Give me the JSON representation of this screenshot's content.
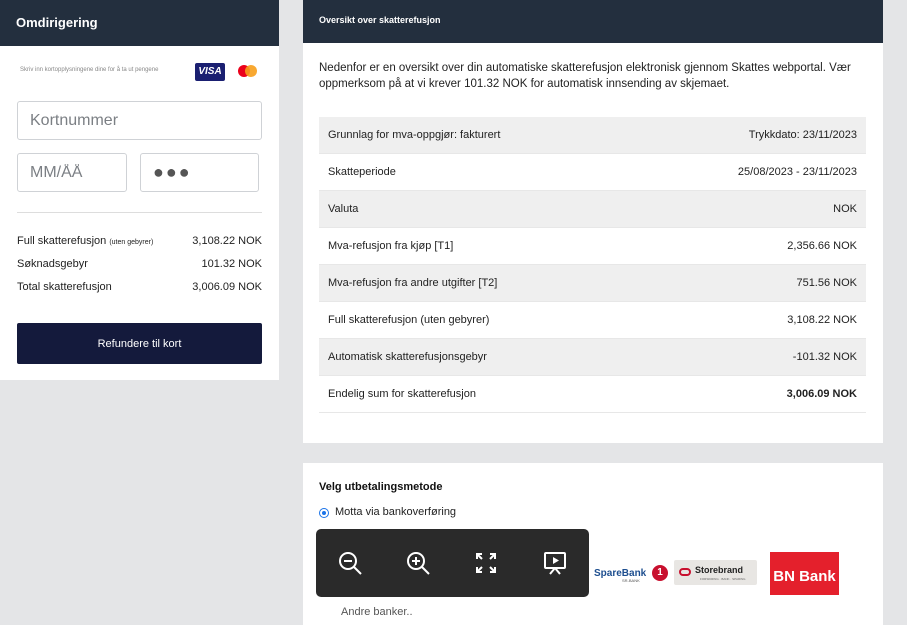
{
  "left_panel": {
    "title": "Omdirigering",
    "card_hint": "Skriv inn kortopplysningene dine for å ta ut pengene",
    "visa_label": "VISA",
    "card_number_placeholder": "Kortnummer",
    "expiry_placeholder": "MM/ÅÅ",
    "cvc_value": "●●●",
    "summary": [
      {
        "label": "Full skatterefusjon",
        "note": "(uten gebyrer)",
        "value": "3,108.22 NOK"
      },
      {
        "label": "Søknadsgebyr",
        "note": "",
        "value": "101.32 NOK"
      },
      {
        "label": "Total skatterefusjon",
        "note": "",
        "value": "3,006.09 NOK"
      }
    ],
    "refund_button": "Refundere til kort"
  },
  "overview": {
    "title": "Oversikt over skatterefusjon",
    "intro": "Nedenfor er en oversikt over din automatiske skatterefusjon elektronisk gjennom Skattes webportal. Vær oppmerksom på at vi krever 101.32 NOK for automatisk innsending av skjemaet.",
    "rows": [
      {
        "label": "Grunnlag for mva-oppgjør: fakturert",
        "value": "Trykkdato: 23/11/2023"
      },
      {
        "label": "Skatteperiode",
        "value": "25/08/2023 - 23/11/2023"
      },
      {
        "label": "Valuta",
        "value": "NOK"
      },
      {
        "label": "Mva-refusjon fra kjøp [T1]",
        "value": "2,356.66 NOK"
      },
      {
        "label": "Mva-refusjon fra andre utgifter [T2]",
        "value": "751.56 NOK"
      },
      {
        "label": "Full skatterefusjon (uten gebyrer)",
        "value": "3,108.22 NOK"
      },
      {
        "label": "Automatisk skatterefusjonsgebyr",
        "value": "-101.32 NOK"
      },
      {
        "label": "Endelig sum for skatterefusjon",
        "value": "3,006.09 NOK"
      }
    ]
  },
  "payout": {
    "title": "Velg utbetalingsmetode",
    "option": "Motta via bankoverføring",
    "banks": {
      "sparebank": "SpareBank",
      "sparebank_number": "1",
      "sparebank_sub": "SR-BANK",
      "storebrand": "Storebrand",
      "storebrand_sub": "FORSIKRING · BANK · SPARING",
      "bnbank": "BN Bank"
    },
    "other_banks": "Andre banker.."
  },
  "viewer_toolbar": {
    "icons": [
      "zoom-out-icon",
      "zoom-in-icon",
      "fullscreen-icon",
      "slideshow-icon"
    ]
  },
  "colors": {
    "header_bg": "#232f3e",
    "button_bg": "#141a3c",
    "bn_bank_red": "#e4202c",
    "radio_blue": "#1a73e8"
  }
}
